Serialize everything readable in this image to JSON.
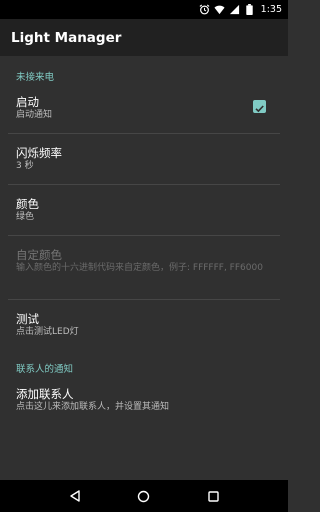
{
  "status_bar": {
    "time": "1:35",
    "icons": [
      "alarm-icon",
      "wifi-icon",
      "signal-icon",
      "battery-icon"
    ]
  },
  "app_bar": {
    "title": "Light Manager"
  },
  "sections": {
    "missed_call": {
      "header": "未接来电"
    },
    "contacts": {
      "header": "联系人的通知"
    }
  },
  "prefs": {
    "enable": {
      "title": "启动",
      "summary": "启动通知",
      "checked": true
    },
    "flash_rate": {
      "title": "闪烁频率",
      "summary": "3 秒"
    },
    "color": {
      "title": "颜色",
      "summary": "绿色"
    },
    "custom_color": {
      "title": "自定颜色",
      "summary": "输入颜色的十六进制代码来自定颜色，例子: FFFFFF, FF6000",
      "enabled": false
    },
    "test": {
      "title": "测试",
      "summary": "点击测试LED灯"
    },
    "add_contact": {
      "title": "添加联系人",
      "summary": "点击这儿来添加联系人，并设置其通知"
    }
  },
  "nav_bar": {
    "buttons": [
      "back-icon",
      "home-icon",
      "recents-icon"
    ]
  },
  "colors": {
    "accent": "#80cbc4",
    "background": "#303030",
    "app_bar": "#212121"
  }
}
